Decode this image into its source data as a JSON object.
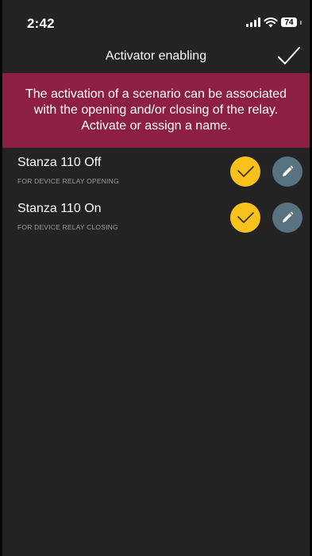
{
  "status_bar": {
    "time": "2:42",
    "battery": "74"
  },
  "nav": {
    "title": "Activator enabling",
    "confirm_icon": "checkmark-icon"
  },
  "banner": {
    "text": "The activation of a scenario can be associated with the opening and/or closing of the relay. Activate or assign a name."
  },
  "items": [
    {
      "title": "Stanza 110 Off",
      "subtitle": "FOR DEVICE RELAY OPENING",
      "active": true
    },
    {
      "title": "Stanza 110 On",
      "subtitle": "FOR DEVICE RELAY CLOSING",
      "active": true
    }
  ],
  "colors": {
    "background": "#232323",
    "banner": "#8d1f45",
    "active_toggle": "#f8c21a",
    "edit_button": "#587280"
  }
}
